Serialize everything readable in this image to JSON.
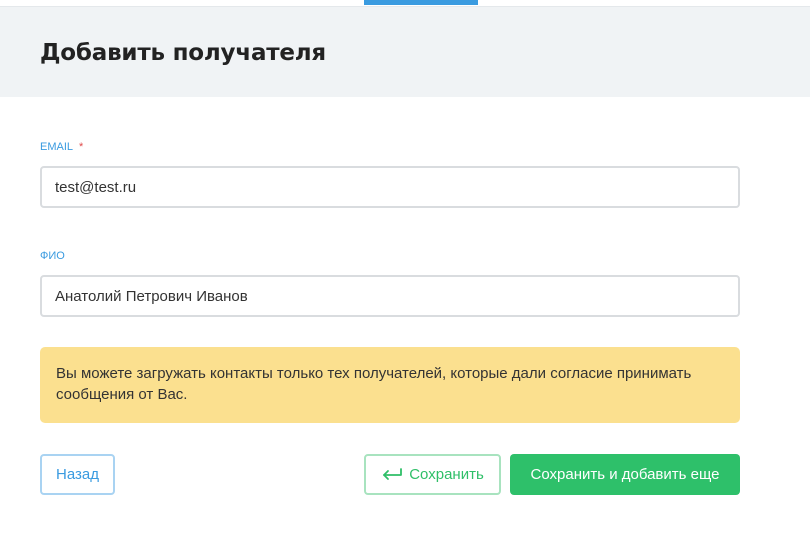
{
  "header": {
    "title": "Добавить получателя"
  },
  "form": {
    "email": {
      "label": "EMAIL",
      "required_mark": "*",
      "value": "test@test.ru"
    },
    "fio": {
      "label": "ФИО",
      "value": "Анатолий Петрович Иванов"
    }
  },
  "notice": {
    "text": "Вы можете загружать контакты только тех получателей, которые дали согласие принимать сообщения от Вас."
  },
  "buttons": {
    "back_label": "Назад",
    "save_label": "Сохранить",
    "save_icon": "return-arrow-icon",
    "save_more_label": "Сохранить и добавить еще"
  },
  "colors": {
    "accent_blue": "#3a9be0",
    "accent_green": "#2ec06a",
    "notice_bg": "#fbe08f",
    "required": "#e04a4a"
  }
}
